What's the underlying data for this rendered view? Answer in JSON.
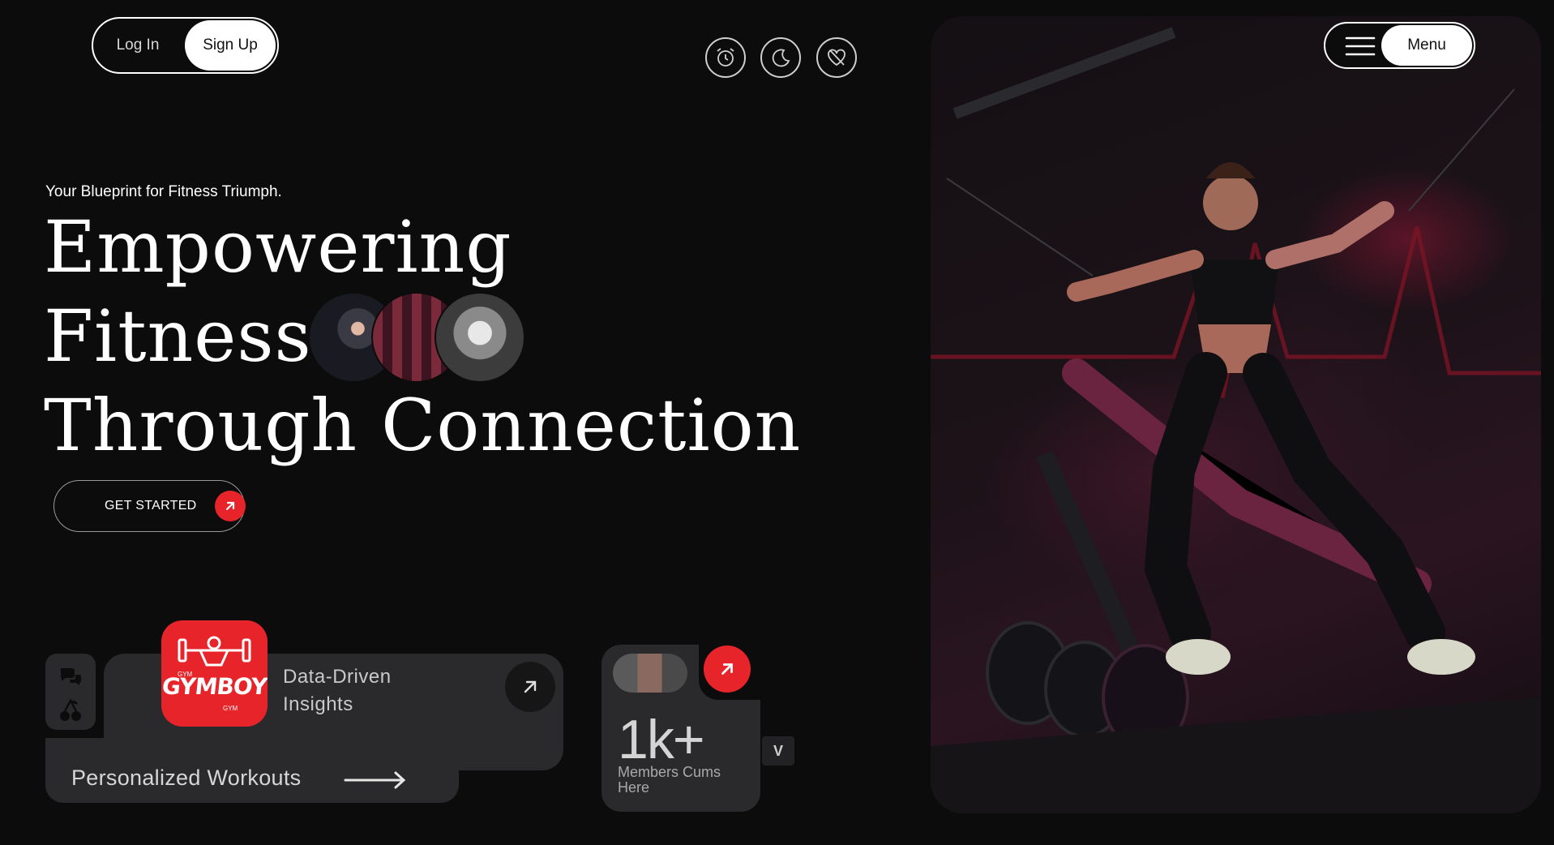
{
  "auth": {
    "login_label": "Log In",
    "signup_label": "Sign Up"
  },
  "toolbar_icons": [
    "alarm-clock-icon",
    "moon-icon",
    "heart-crossed-icon"
  ],
  "hero": {
    "tagline": "Your Blueprint for Fitness Triumph.",
    "headline_lines": [
      "Empowering",
      "Fitness",
      "Through Connection"
    ],
    "cta_label": "GET STARTED"
  },
  "features": {
    "logo_brand": "GYMBOY",
    "logo_small_top": "GYM",
    "logo_small_bottom": "GYM",
    "insights_title": "Data-Driven Insights",
    "workouts_title": "Personalized Workouts"
  },
  "members": {
    "count": "1k+",
    "caption": "Members Cums Here",
    "badge": "V"
  },
  "nav": {
    "menu_label": "Menu"
  },
  "colors": {
    "accent": "#e8242b",
    "background": "#0c0c0d",
    "card": "#2a2a2c"
  }
}
